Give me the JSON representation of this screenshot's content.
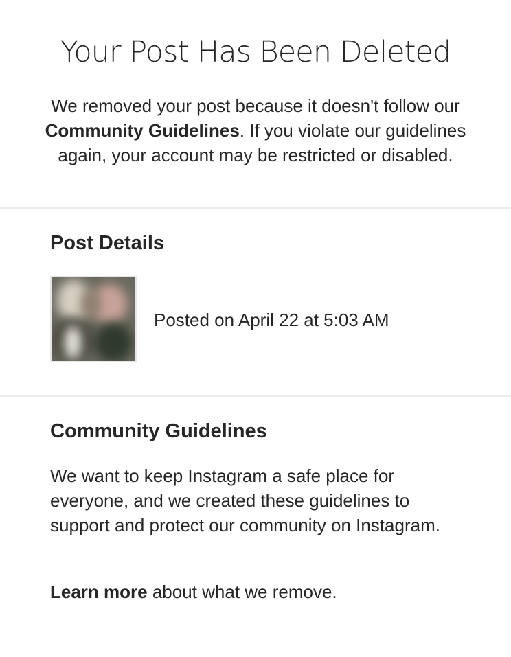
{
  "header": {
    "title": "Your Post Has Been Deleted",
    "intro_part1": "We removed your post because it doesn't follow our ",
    "intro_link": "Community Guidelines",
    "intro_part2": ". If you violate our guidelines again, your account may be restricted or disabled."
  },
  "post_details": {
    "title": "Post Details",
    "posted_on": "Posted on April 22 at 5:03 AM"
  },
  "community_guidelines": {
    "title": "Community Guidelines",
    "body": "We want to keep Instagram a safe place for everyone, and we created these guidelines to support and protect our community on Instagram.",
    "learn_more_link": "Learn more",
    "learn_more_rest": " about what we remove."
  },
  "colors": {
    "text": "#262626",
    "divider": "#ececec",
    "background": "#ffffff"
  }
}
